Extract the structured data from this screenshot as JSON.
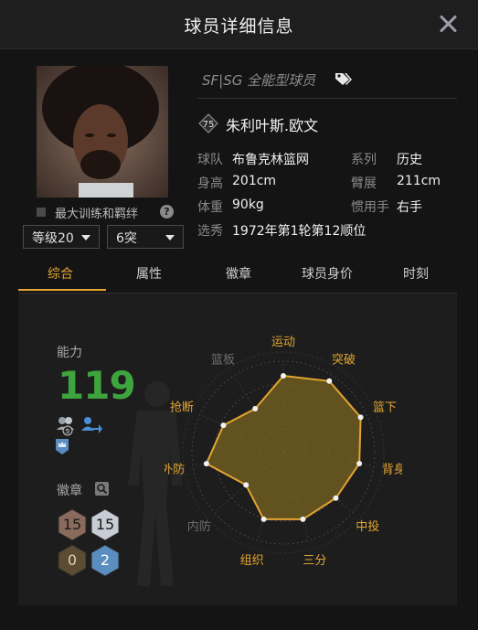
{
  "dialog": {
    "title": "球员详细信息"
  },
  "player": {
    "position": "SF|SG 全能型球员",
    "overall": "75",
    "name": "朱利叶斯.欧文"
  },
  "info": {
    "team_label": "球队",
    "team": "布鲁克林篮网",
    "series_label": "系列",
    "series": "历史",
    "height_label": "身高",
    "height": "201cm",
    "wingspan_label": "臂展",
    "wingspan": "211cm",
    "weight_label": "体重",
    "weight": "90kg",
    "hand_label": "惯用手",
    "hand": "右手",
    "draft_label": "选秀",
    "draft": "1972年第1轮第12顺位"
  },
  "controls": {
    "max_training_label": "最大训练和羁绊",
    "help_glyph": "?",
    "level_select": "等级20",
    "breakthrough_select": "6突"
  },
  "tabs": [
    "综合",
    "属性",
    "徽章",
    "球员身价",
    "时刻"
  ],
  "stats": {
    "ability_label": "能力",
    "ability_value": "119",
    "chemistry_count": "5",
    "badges_label": "徽章",
    "badges": [
      {
        "value": "15",
        "tier": "bronze",
        "color": "#8a6a5c"
      },
      {
        "value": "15",
        "tier": "silver",
        "color": "#c8ccd4"
      },
      {
        "value": "0",
        "tier": "gold",
        "color": "#5a4d33"
      },
      {
        "value": "2",
        "tier": "blue",
        "color": "#5a8ec0"
      }
    ]
  },
  "radar": {
    "labels": [
      "运动",
      "突破",
      "篮下",
      "背身",
      "中投",
      "三分",
      "组织",
      "内防",
      "外防",
      "抢断",
      "篮板"
    ],
    "active": [
      true,
      true,
      true,
      true,
      true,
      true,
      true,
      false,
      true,
      true,
      false
    ],
    "values": [
      0.84,
      0.93,
      0.93,
      0.84,
      0.76,
      0.76,
      0.76,
      0.54,
      0.85,
      0.72,
      0.57
    ],
    "colors": {
      "active": "#e3a531",
      "inactive": "#6e6e6e",
      "fill": "#7a6422",
      "accent": "#e3a531"
    }
  },
  "theme": {
    "accent": "#e3a531",
    "ability_green": "#3ea43e"
  }
}
